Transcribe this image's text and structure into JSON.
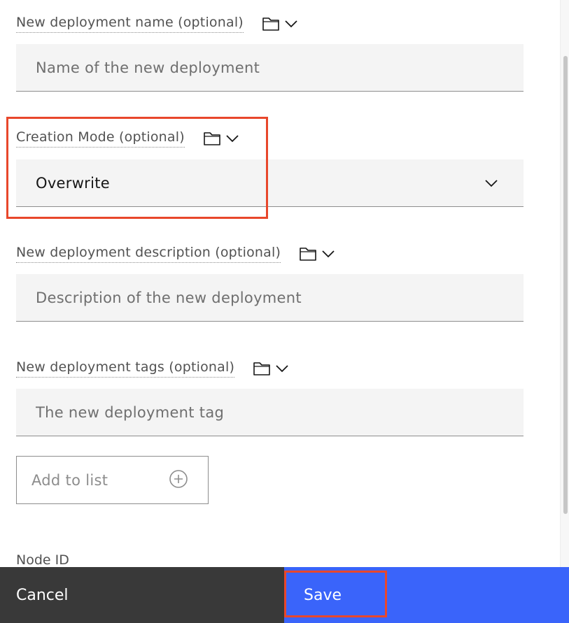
{
  "fields": {
    "deployment_name": {
      "label": "New deployment name (optional)",
      "placeholder": "Name of the new deployment"
    },
    "creation_mode": {
      "label": "Creation Mode (optional)",
      "value": "Overwrite"
    },
    "deployment_description": {
      "label": "New deployment description (optional)",
      "placeholder": "Description of the new deployment"
    },
    "deployment_tags": {
      "label": "New deployment tags (optional)",
      "placeholder": "The new deployment tag"
    }
  },
  "add_to_list": {
    "label": "Add to list"
  },
  "node_id": {
    "label": "Node ID"
  },
  "footer": {
    "cancel_label": "Cancel",
    "save_label": "Save"
  },
  "colors": {
    "primary_button": "#3a64fa",
    "secondary_button": "#393939",
    "highlight": "#e8472b",
    "field_background": "#f4f4f4"
  },
  "icons": {
    "label_folder": "folder-icon",
    "label_chevron": "chevron-down-icon",
    "select_chevron": "chevron-down-icon",
    "add": "add-circle-icon"
  }
}
